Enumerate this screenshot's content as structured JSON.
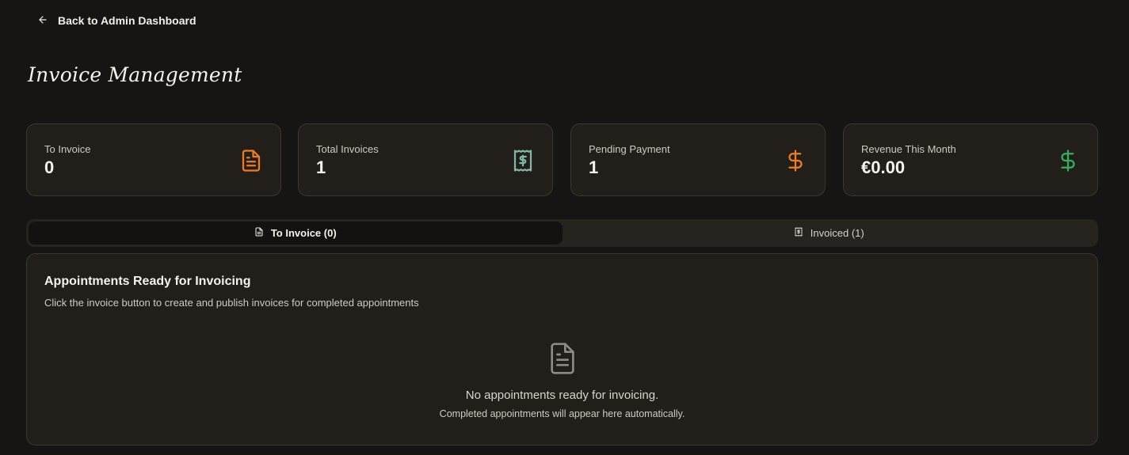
{
  "nav": {
    "back_label": "Back to Admin Dashboard"
  },
  "page": {
    "title": "Invoice Management"
  },
  "stats": [
    {
      "label": "To Invoice",
      "value": "0",
      "icon": "file-text-icon",
      "color": "#f07b22"
    },
    {
      "label": "Total Invoices",
      "value": "1",
      "icon": "receipt-icon",
      "color": "#7fb7a0"
    },
    {
      "label": "Pending Payment",
      "value": "1",
      "icon": "dollar-icon",
      "color": "#f07b22"
    },
    {
      "label": "Revenue This Month",
      "value": "€0.00",
      "icon": "dollar-icon",
      "color": "#2fb35a"
    }
  ],
  "tabs": [
    {
      "label": "To Invoice (0)",
      "icon": "file-text-icon",
      "active": true
    },
    {
      "label": "Invoiced (1)",
      "icon": "receipt-icon",
      "active": false
    }
  ],
  "panel": {
    "title": "Appointments Ready for Invoicing",
    "description": "Click the invoice button to create and publish invoices for completed appointments",
    "empty_icon": "file-text-icon",
    "empty_title": "No appointments ready for invoicing.",
    "empty_subtitle": "Completed appointments will appear here automatically."
  }
}
